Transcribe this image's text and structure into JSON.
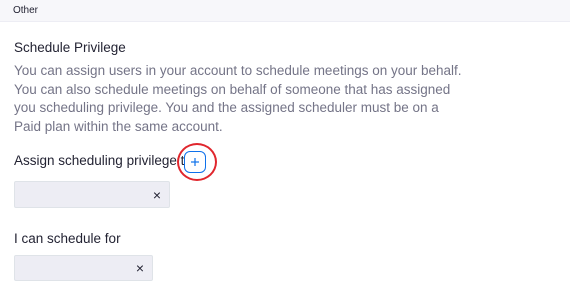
{
  "section": {
    "header": "Other"
  },
  "schedule_privilege": {
    "title": "Schedule Privilege",
    "description": "You can assign users in your account to schedule meetings on your behalf. You can also schedule meetings on behalf of someone that has assigned you scheduling privilege. You and the assigned scheduler must be on a Paid plan within the same account.",
    "assign_label": "Assign scheduling privilege to",
    "add_button_glyph": "+",
    "assigned_remove_glyph": "×",
    "schedule_for_label": "I can schedule for",
    "schedule_for_remove_glyph": "×"
  },
  "colors": {
    "accent": "#0e71eb",
    "highlight": "#e0262d",
    "chip_background": "#ededf4"
  },
  "icons": {
    "add": "plus-icon",
    "remove": "close-icon"
  }
}
